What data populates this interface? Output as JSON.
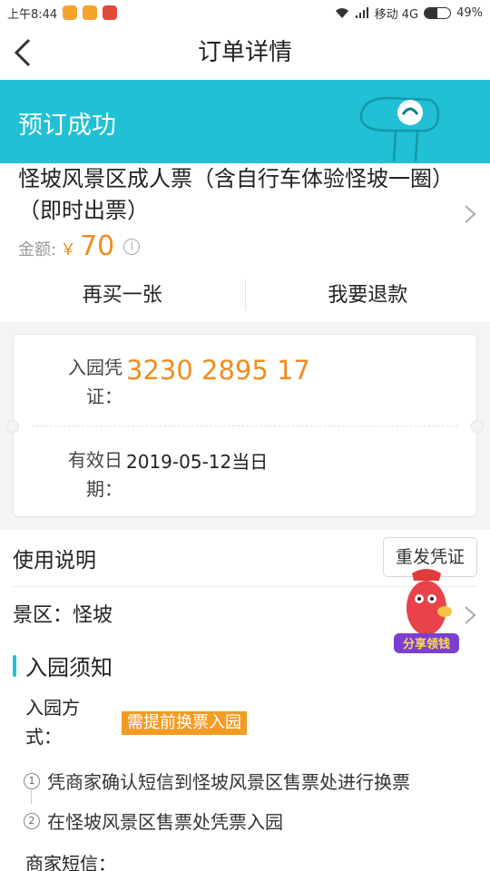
{
  "statusbar": {
    "time": "上午8:44",
    "network": "移动 4G",
    "battery": "49%",
    "battery_level": 0.49,
    "app_icon_colors": [
      "#f4a42a",
      "#f4a42a",
      "#e04a3a"
    ]
  },
  "navbar": {
    "title": "订单详情",
    "back_icon": "chevron-left-icon"
  },
  "banner": {
    "text": "预订成功",
    "color": "#21c0d4"
  },
  "product": {
    "title": "怪坡风景区成人票（含自行车体验怪坡一圈）（即时出票）",
    "amount_label": "金额:",
    "currency": "￥",
    "amount": "70",
    "info_icon": "ⓘ"
  },
  "actions": {
    "buy_again": "再买一张",
    "refund": "我要退款"
  },
  "voucher": {
    "code_label": "入园凭证：",
    "code": "3230 2895 17",
    "valid_label": "有效日期：",
    "valid_value": "2019-05-12当日"
  },
  "usage": {
    "title": "使用说明",
    "resend_button": "重发凭证",
    "scenic": "景区：怪坡",
    "entry_title": "入园须知",
    "method_label": "入园方式：",
    "method_badge": "需提前换票入园",
    "steps": [
      {
        "num": "1",
        "text": "凭商家确认短信到怪坡风景区售票处进行换票"
      },
      {
        "num": "2",
        "text": "在怪坡风景区售票处凭票入园"
      }
    ],
    "sms_label": "商家短信：",
    "promo_text": "分享领钱"
  },
  "colors": {
    "accent": "#21c0d4",
    "orange": "#f08c1e",
    "badge": "#f39c24"
  }
}
